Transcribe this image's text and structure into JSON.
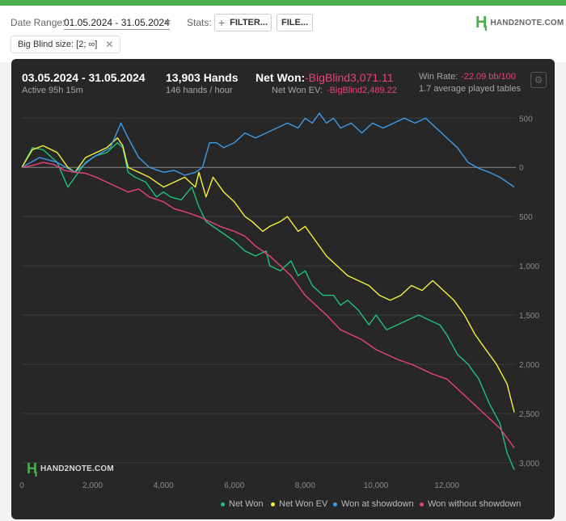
{
  "toolbar": {
    "date_range_label": "Date Range:",
    "date_range_value": "01.05.2024 - 31.05.2024",
    "stats_label": "Stats:",
    "filter_button": "FILTER...",
    "file_button": "FILE...",
    "brand": "HAND2NOTE.COM"
  },
  "filter_chip": {
    "label": "Big Blind size: [2; ∞]"
  },
  "summary": {
    "period": "03.05.2024 - 31.05.2024",
    "active": "Active 95h 15m",
    "hands": "13,903 Hands",
    "hands_per_hour": "146 hands / hour",
    "net_won_label": "Net Won:",
    "net_won_value": "-BigBlind3,071.11",
    "net_won_ev_label": "Net Won  EV:",
    "net_won_ev_value": "-BigBlind2,489.22",
    "win_rate_label": "Win Rate:",
    "win_rate_value": "-22.09 bb/100",
    "tables": "1.7 average played tables"
  },
  "watermark": "HAND2NOTE.COM",
  "colors": {
    "net_won": "#20c27a",
    "net_won_ev": "#f5f23c",
    "won_at_showdown": "#3f9be6",
    "won_without_showdown": "#e8437a",
    "accent": "#4caf50"
  },
  "chart_data": {
    "type": "line",
    "x_ticks": [
      0,
      2000,
      4000,
      6000,
      8000,
      10000,
      12000
    ],
    "x_tick_labels": [
      "0",
      "2,000",
      "4,000",
      "6,000",
      "8,000",
      "10,000",
      "12,000"
    ],
    "y_ticks": [
      500,
      0,
      -500,
      -1000,
      -1500,
      -2000,
      -2500,
      -3000
    ],
    "y_tick_labels": [
      "500",
      "0",
      "500",
      "1,000",
      "1,500",
      "2,000",
      "2,500",
      "3,000"
    ],
    "xlim": [
      0,
      13903
    ],
    "ylim": [
      -3100,
      650
    ],
    "grid": true,
    "legend_position": "bottom",
    "series": [
      {
        "name": "Net Won",
        "key": "net_won",
        "x": [
          0,
          300,
          600,
          1000,
          1300,
          1500,
          1800,
          2100,
          2400,
          2700,
          2850,
          3000,
          3200,
          3500,
          3800,
          4000,
          4200,
          4500,
          4800,
          5000,
          5200,
          5400,
          5600,
          5800,
          6000,
          6300,
          6600,
          6900,
          7000,
          7300,
          7600,
          7800,
          8000,
          8200,
          8500,
          8800,
          9000,
          9200,
          9500,
          9800,
          10000,
          10300,
          10600,
          10900,
          11200,
          11500,
          11800,
          12000,
          12300,
          12600,
          12900,
          13200,
          13500,
          13700,
          13903
        ],
        "y": [
          0,
          200,
          180,
          50,
          -200,
          -100,
          50,
          120,
          150,
          250,
          200,
          -50,
          -100,
          -150,
          -300,
          -250,
          -300,
          -330,
          -200,
          -400,
          -550,
          -600,
          -650,
          -700,
          -750,
          -850,
          -900,
          -850,
          -1000,
          -1050,
          -950,
          -1100,
          -1050,
          -1200,
          -1300,
          -1300,
          -1400,
          -1350,
          -1450,
          -1600,
          -1500,
          -1650,
          -1600,
          -1550,
          -1500,
          -1550,
          -1600,
          -1700,
          -1900,
          -2000,
          -2150,
          -2400,
          -2600,
          -2900,
          -3071
        ]
      },
      {
        "name": "Net Won  EV",
        "key": "net_won_ev",
        "x": [
          0,
          300,
          600,
          1000,
          1300,
          1500,
          1800,
          2100,
          2400,
          2700,
          2850,
          3000,
          3300,
          3600,
          4000,
          4300,
          4600,
          4900,
          5000,
          5200,
          5400,
          5700,
          6000,
          6300,
          6500,
          6800,
          7000,
          7300,
          7500,
          7800,
          8000,
          8300,
          8600,
          8900,
          9200,
          9500,
          9800,
          10100,
          10400,
          10700,
          11000,
          11300,
          11600,
          11900,
          12200,
          12500,
          12800,
          13100,
          13400,
          13700,
          13903
        ],
        "y": [
          0,
          180,
          220,
          150,
          0,
          -50,
          100,
          150,
          200,
          300,
          220,
          0,
          -50,
          -100,
          -200,
          -150,
          -100,
          -200,
          -50,
          -300,
          -100,
          -250,
          -350,
          -500,
          -550,
          -650,
          -600,
          -550,
          -500,
          -650,
          -600,
          -750,
          -900,
          -1000,
          -1100,
          -1150,
          -1200,
          -1300,
          -1350,
          -1300,
          -1200,
          -1250,
          -1150,
          -1250,
          -1350,
          -1500,
          -1700,
          -1850,
          -2000,
          -2200,
          -2489
        ]
      },
      {
        "name": "Won at showdown",
        "key": "won_at_showdown",
        "x": [
          0,
          500,
          1000,
          1500,
          2000,
          2500,
          2800,
          3000,
          3300,
          3600,
          4000,
          4300,
          4600,
          4900,
          5100,
          5300,
          5500,
          5700,
          6000,
          6300,
          6600,
          6900,
          7200,
          7500,
          7800,
          8000,
          8200,
          8400,
          8600,
          8800,
          9000,
          9300,
          9600,
          9900,
          10200,
          10500,
          10800,
          11100,
          11400,
          11700,
          12000,
          12300,
          12600,
          12900,
          13200,
          13500,
          13700,
          13903
        ],
        "y": [
          0,
          100,
          50,
          -50,
          100,
          200,
          450,
          300,
          100,
          0,
          -50,
          -30,
          -80,
          -50,
          0,
          250,
          250,
          200,
          250,
          350,
          300,
          350,
          400,
          450,
          400,
          500,
          450,
          550,
          450,
          500,
          400,
          450,
          350,
          450,
          400,
          450,
          500,
          450,
          500,
          400,
          300,
          200,
          50,
          -10,
          -50,
          -100,
          -150,
          -200
        ]
      },
      {
        "name": "Won without showdown",
        "key": "won_without_showdown",
        "x": [
          0,
          300,
          600,
          900,
          1200,
          1500,
          1800,
          2100,
          2400,
          2700,
          3000,
          3300,
          3600,
          4000,
          4300,
          4600,
          5000,
          5300,
          5600,
          6000,
          6300,
          6600,
          7000,
          7300,
          7600,
          8000,
          8300,
          8600,
          9000,
          9300,
          9600,
          10000,
          10300,
          10600,
          11000,
          11300,
          11600,
          12000,
          12300,
          12600,
          12900,
          13200,
          13500,
          13700,
          13903
        ],
        "y": [
          0,
          20,
          50,
          30,
          -30,
          -50,
          -60,
          -100,
          -150,
          -200,
          -250,
          -220,
          -300,
          -350,
          -420,
          -450,
          -500,
          -550,
          -600,
          -650,
          -700,
          -800,
          -900,
          -1000,
          -1100,
          -1300,
          -1400,
          -1500,
          -1650,
          -1700,
          -1750,
          -1850,
          -1900,
          -1950,
          -2000,
          -2050,
          -2100,
          -2150,
          -2250,
          -2350,
          -2450,
          -2550,
          -2650,
          -2750,
          -2850
        ]
      }
    ]
  }
}
